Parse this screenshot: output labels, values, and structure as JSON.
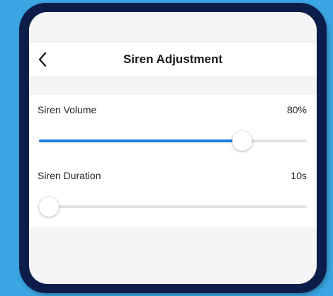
{
  "colors": {
    "background": "#3aa5e2",
    "device_frame": "#0c1d4a",
    "accent": "#1f7be8"
  },
  "navbar": {
    "back_icon": "chevron-left-icon",
    "title": "Siren Adjustment"
  },
  "settings": [
    {
      "label": "Siren Volume",
      "value_text": "80%",
      "level_fraction": 0.78
    },
    {
      "label": "Siren Duration",
      "value_text": "10s",
      "level_fraction": 0.0
    }
  ]
}
